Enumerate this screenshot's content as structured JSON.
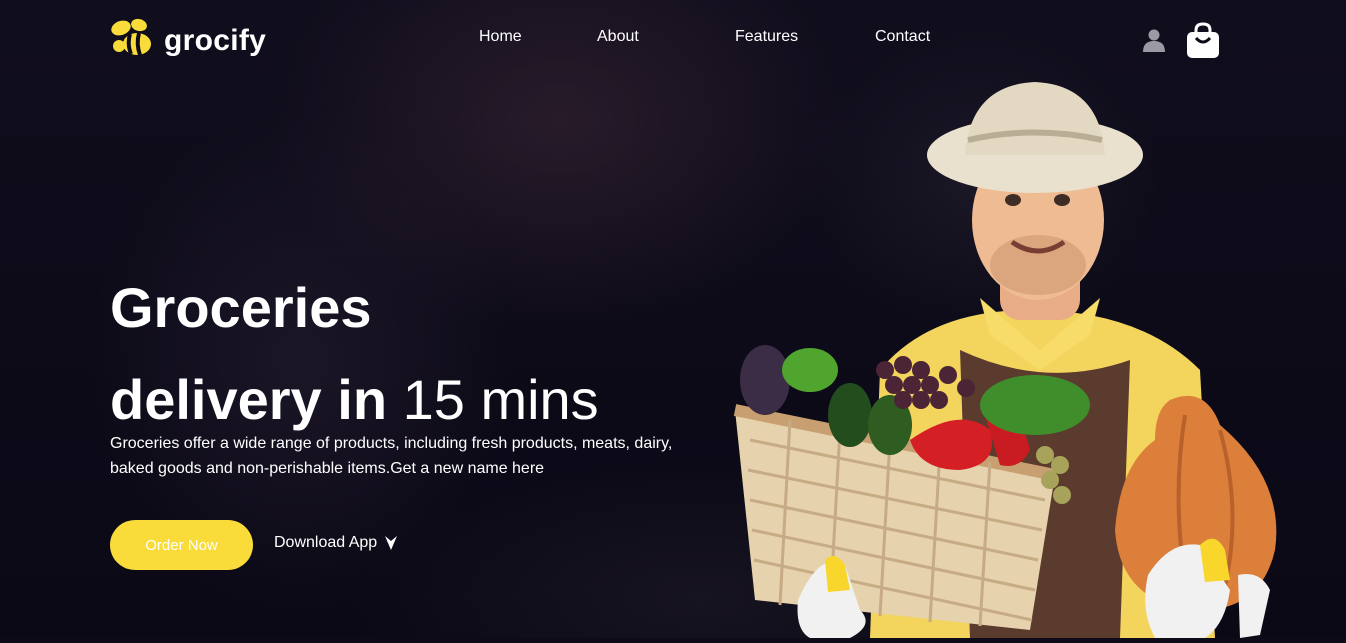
{
  "brand": {
    "name": "grocify",
    "accent": "#f9dc3a"
  },
  "nav": {
    "items": [
      {
        "label": "Home"
      },
      {
        "label": "About"
      },
      {
        "label": "Features"
      },
      {
        "label": "Contact"
      }
    ],
    "icons": [
      "user-icon",
      "shopping-bag-icon"
    ]
  },
  "hero": {
    "title_line1": "Groceries",
    "title_line2_bold": "delivery in",
    "title_line2_normal": "15 mins",
    "description": "Groceries offer a wide range of products, including fresh products, meats, dairy, baked goods and non-perishable items.Get a new name here",
    "order_button": "Order Now",
    "download_button": "Download App",
    "image": "farmer-with-vegetable-basket"
  }
}
